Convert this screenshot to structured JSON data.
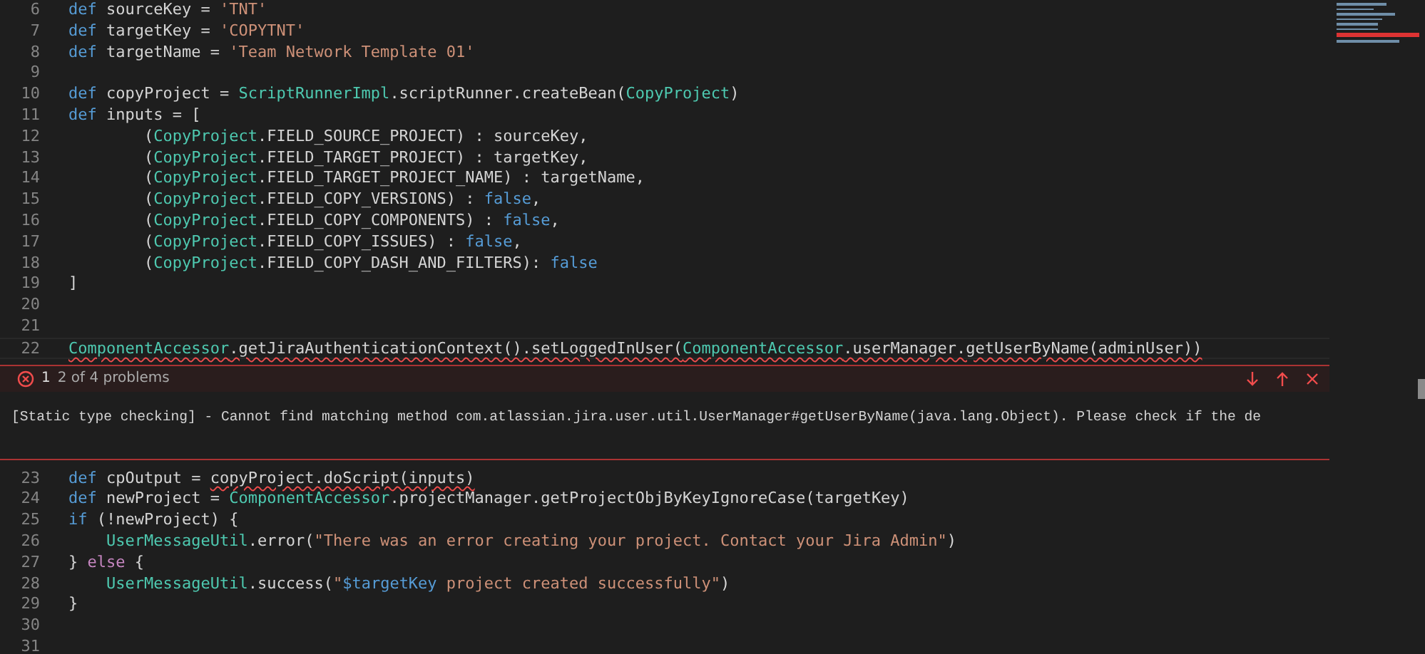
{
  "editor": {
    "lines_before": [
      {
        "number": "6",
        "tokens": [
          {
            "text": "def",
            "kind": "keyword"
          },
          {
            "text": " sourceKey = ",
            "kind": "plain"
          },
          {
            "text": "'TNT'",
            "kind": "string"
          }
        ]
      },
      {
        "number": "7",
        "tokens": [
          {
            "text": "def",
            "kind": "keyword"
          },
          {
            "text": " targetKey = ",
            "kind": "plain"
          },
          {
            "text": "'COPYTNT'",
            "kind": "string"
          }
        ]
      },
      {
        "number": "8",
        "tokens": [
          {
            "text": "def",
            "kind": "keyword"
          },
          {
            "text": " targetName = ",
            "kind": "plain"
          },
          {
            "text": "'Team Network Template 01'",
            "kind": "string"
          }
        ]
      },
      {
        "number": "9"
      },
      {
        "number": "10",
        "tokens": [
          {
            "text": "def",
            "kind": "keyword"
          },
          {
            "text": " copyProject = ",
            "kind": "plain"
          },
          {
            "text": "ScriptRunnerImpl",
            "kind": "type"
          },
          {
            "text": ".scriptRunner.createBean(",
            "kind": "plain"
          },
          {
            "text": "CopyProject",
            "kind": "type"
          },
          {
            "text": ")",
            "kind": "plain"
          }
        ]
      },
      {
        "number": "11",
        "tokens": [
          {
            "text": "def",
            "kind": "keyword"
          },
          {
            "text": " inputs = [",
            "kind": "plain"
          }
        ]
      },
      {
        "number": "12",
        "tokens": [
          {
            "text": "        (",
            "kind": "plain"
          },
          {
            "text": "CopyProject",
            "kind": "type"
          },
          {
            "text": ".FIELD_SOURCE_PROJECT) : sourceKey,",
            "kind": "plain"
          }
        ]
      },
      {
        "number": "13",
        "tokens": [
          {
            "text": "        (",
            "kind": "plain"
          },
          {
            "text": "CopyProject",
            "kind": "type"
          },
          {
            "text": ".FIELD_TARGET_PROJECT) : targetKey,",
            "kind": "plain"
          }
        ]
      },
      {
        "number": "14",
        "tokens": [
          {
            "text": "        (",
            "kind": "plain"
          },
          {
            "text": "CopyProject",
            "kind": "type"
          },
          {
            "text": ".FIELD_TARGET_PROJECT_NAME) : targetName,",
            "kind": "plain"
          }
        ]
      },
      {
        "number": "15",
        "tokens": [
          {
            "text": "        (",
            "kind": "plain"
          },
          {
            "text": "CopyProject",
            "kind": "type"
          },
          {
            "text": ".FIELD_COPY_VERSIONS) : ",
            "kind": "plain"
          },
          {
            "text": "false",
            "kind": "keyword"
          },
          {
            "text": ",",
            "kind": "plain"
          }
        ]
      },
      {
        "number": "16",
        "tokens": [
          {
            "text": "        (",
            "kind": "plain"
          },
          {
            "text": "CopyProject",
            "kind": "type"
          },
          {
            "text": ".FIELD_COPY_COMPONENTS) : ",
            "kind": "plain"
          },
          {
            "text": "false",
            "kind": "keyword"
          },
          {
            "text": ",",
            "kind": "plain"
          }
        ]
      },
      {
        "number": "17",
        "tokens": [
          {
            "text": "        (",
            "kind": "plain"
          },
          {
            "text": "CopyProject",
            "kind": "type"
          },
          {
            "text": ".FIELD_COPY_ISSUES) : ",
            "kind": "plain"
          },
          {
            "text": "false",
            "kind": "keyword"
          },
          {
            "text": ",",
            "kind": "plain"
          }
        ]
      },
      {
        "number": "18",
        "tokens": [
          {
            "text": "        (",
            "kind": "plain"
          },
          {
            "text": "CopyProject",
            "kind": "type"
          },
          {
            "text": ".FIELD_COPY_DASH_AND_FILTERS): ",
            "kind": "plain"
          },
          {
            "text": "false",
            "kind": "keyword"
          }
        ]
      },
      {
        "number": "19",
        "tokens": [
          {
            "text": "]",
            "kind": "plain"
          }
        ]
      },
      {
        "number": "20"
      },
      {
        "number": "21"
      },
      {
        "number": "22",
        "tokens": [
          {
            "text": "ComponentAccessor",
            "kind": "type",
            "error": true
          },
          {
            "text": ".getJiraAuthenticationContext().setLoggedInUser(",
            "kind": "plain",
            "error": true
          },
          {
            "text": "ComponentAccessor",
            "kind": "type",
            "error": true
          },
          {
            "text": ".userManager.getUserByName(adminUser))",
            "kind": "plain",
            "error": true
          }
        ]
      }
    ],
    "problem": {
      "index": "1",
      "count": "2 of 4 problems",
      "message": "[Static type checking] - Cannot find matching method com.atlassian.jira.user.util.UserManager#getUserByName(java.lang.Object). Please check if the de"
    },
    "lines_after": [
      {
        "number": "23",
        "tokens": [
          {
            "text": "def",
            "kind": "keyword"
          },
          {
            "text": " cpOutput = ",
            "kind": "plain"
          },
          {
            "text": "copyProject.doScript(inputs)",
            "kind": "plain",
            "error": true
          }
        ]
      },
      {
        "number": "24",
        "tokens": [
          {
            "text": "def",
            "kind": "keyword"
          },
          {
            "text": " newProject = ",
            "kind": "plain"
          },
          {
            "text": "ComponentAccessor",
            "kind": "type"
          },
          {
            "text": ".projectManager.getProjectObjByKeyIgnoreCase(targetKey)",
            "kind": "plain"
          }
        ]
      },
      {
        "number": "25",
        "tokens": [
          {
            "text": "if",
            "kind": "keyword"
          },
          {
            "text": " (!newProject) {",
            "kind": "plain"
          }
        ]
      },
      {
        "number": "26",
        "tokens": [
          {
            "text": "    UserMessageUtil",
            "kind": "type"
          },
          {
            "text": ".error(",
            "kind": "plain"
          },
          {
            "text": "\"There was an error creating your project. Contact your Jira Admin\"",
            "kind": "string"
          },
          {
            "text": ")",
            "kind": "plain"
          }
        ]
      },
      {
        "number": "27",
        "tokens": [
          {
            "text": "} ",
            "kind": "plain"
          },
          {
            "text": "else",
            "kind": "control"
          },
          {
            "text": " {",
            "kind": "plain"
          }
        ]
      },
      {
        "number": "28",
        "tokens": [
          {
            "text": "    UserMessageUtil",
            "kind": "type"
          },
          {
            "text": ".success(",
            "kind": "plain"
          },
          {
            "text": "\"",
            "kind": "string"
          },
          {
            "text": "$targetKey",
            "kind": "keyword"
          },
          {
            "text": " project created successfully\"",
            "kind": "string"
          },
          {
            "text": ")",
            "kind": "plain"
          }
        ]
      },
      {
        "number": "29",
        "tokens": [
          {
            "text": "}",
            "kind": "plain"
          }
        ]
      },
      {
        "number": "30"
      },
      {
        "number": "31"
      }
    ]
  }
}
